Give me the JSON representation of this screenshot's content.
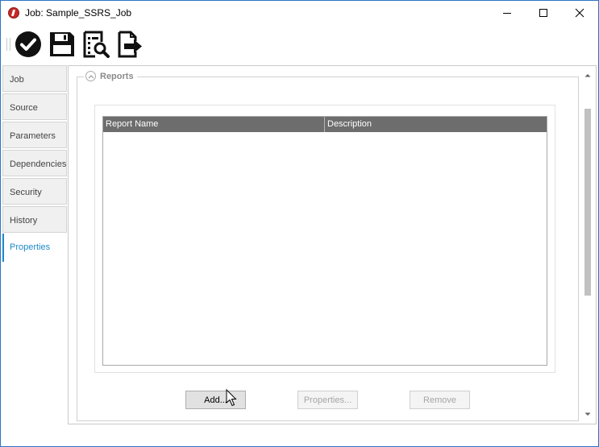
{
  "window": {
    "title": "Job: Sample_SSRS_Job",
    "controls": [
      "minimize",
      "maximize",
      "close"
    ]
  },
  "toolbar": {
    "buttons": [
      {
        "name": "save-and-close",
        "icon": "checkmark-circle-icon"
      },
      {
        "name": "save",
        "icon": "floppy-disk-icon"
      },
      {
        "name": "preview",
        "icon": "document-search-icon"
      },
      {
        "name": "export",
        "icon": "document-export-icon"
      }
    ]
  },
  "tabs": [
    {
      "label": "Job",
      "active": false
    },
    {
      "label": "Source",
      "active": false
    },
    {
      "label": "Parameters",
      "active": false
    },
    {
      "label": "Dependencies",
      "active": false
    },
    {
      "label": "Security",
      "active": false
    },
    {
      "label": "History",
      "active": false
    },
    {
      "label": "Properties",
      "active": true
    }
  ],
  "reports": {
    "section_title": "Reports",
    "columns": [
      "Report Name",
      "Description"
    ],
    "rows": [],
    "buttons": {
      "add": {
        "label": "Add...",
        "enabled": true
      },
      "properties": {
        "label": "Properties...",
        "enabled": false
      },
      "remove": {
        "label": "Remove",
        "enabled": false
      }
    }
  },
  "colors": {
    "accent": "#1e88c8",
    "grid_header": "#6d6d6d",
    "window_border": "#2b74c7"
  }
}
